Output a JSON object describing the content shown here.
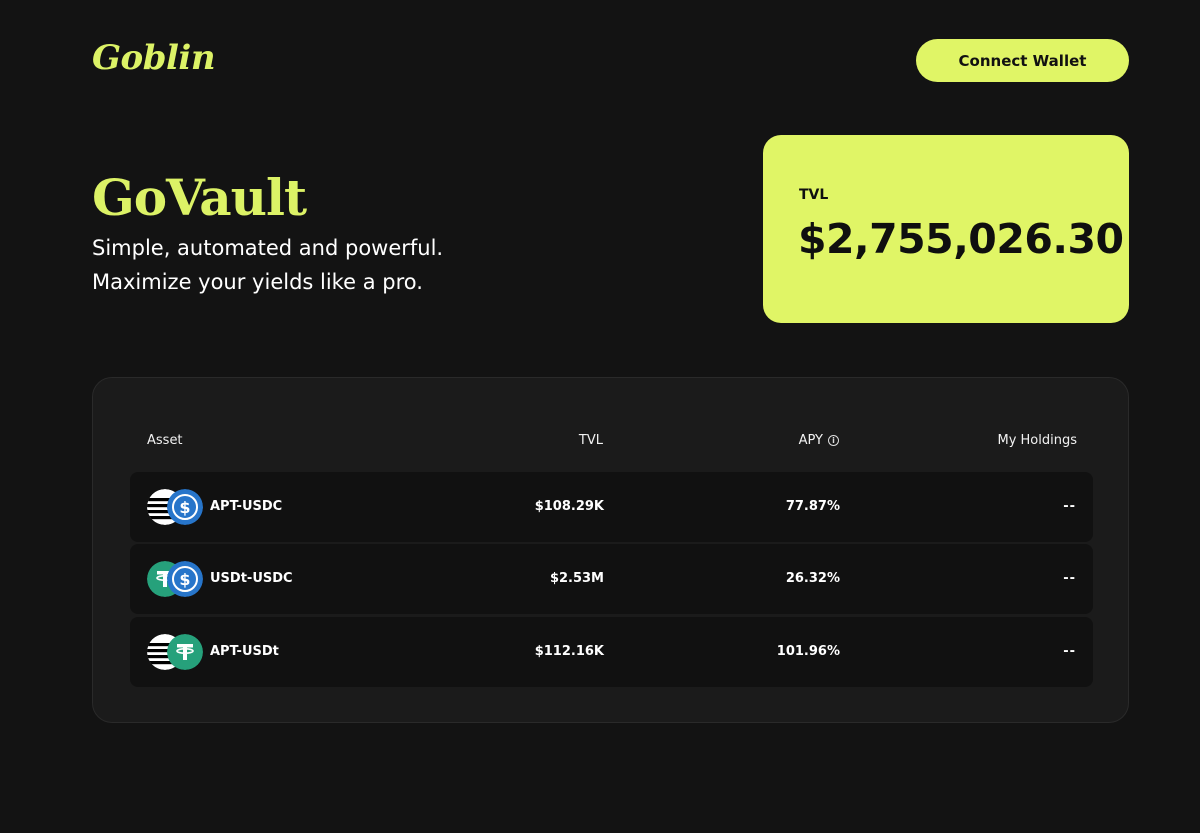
{
  "header": {
    "logo": "Goblin",
    "connect_label": "Connect Wallet"
  },
  "hero": {
    "title": "GoVault",
    "line1": "Simple, automated and powerful.",
    "line2": "Maximize your yields like a pro."
  },
  "tvl_card": {
    "label": "TVL",
    "value": "$2,755,026.30"
  },
  "table": {
    "columns": {
      "asset": "Asset",
      "tvl": "TVL",
      "apy": "APY",
      "holdings": "My Holdings"
    },
    "rows": [
      {
        "asset": "APT-USDC",
        "tvl": "$108.29K",
        "apy": "77.87%",
        "holdings": "--",
        "icons": [
          "aptos-icon",
          "usdc-icon"
        ]
      },
      {
        "asset": "USDt-USDC",
        "tvl": "$2.53M",
        "apy": "26.32%",
        "holdings": "--",
        "icons": [
          "usdt-icon",
          "usdc-icon"
        ]
      },
      {
        "asset": "APT-USDt",
        "tvl": "$112.16K",
        "apy": "101.96%",
        "holdings": "--",
        "icons": [
          "aptos-icon",
          "usdt-icon"
        ]
      }
    ]
  },
  "colors": {
    "accent": "#e0f566",
    "background": "#131313",
    "panel": "#1b1b1b",
    "row": "#111111",
    "usdc": "#2775ca",
    "usdt": "#26a17b"
  }
}
